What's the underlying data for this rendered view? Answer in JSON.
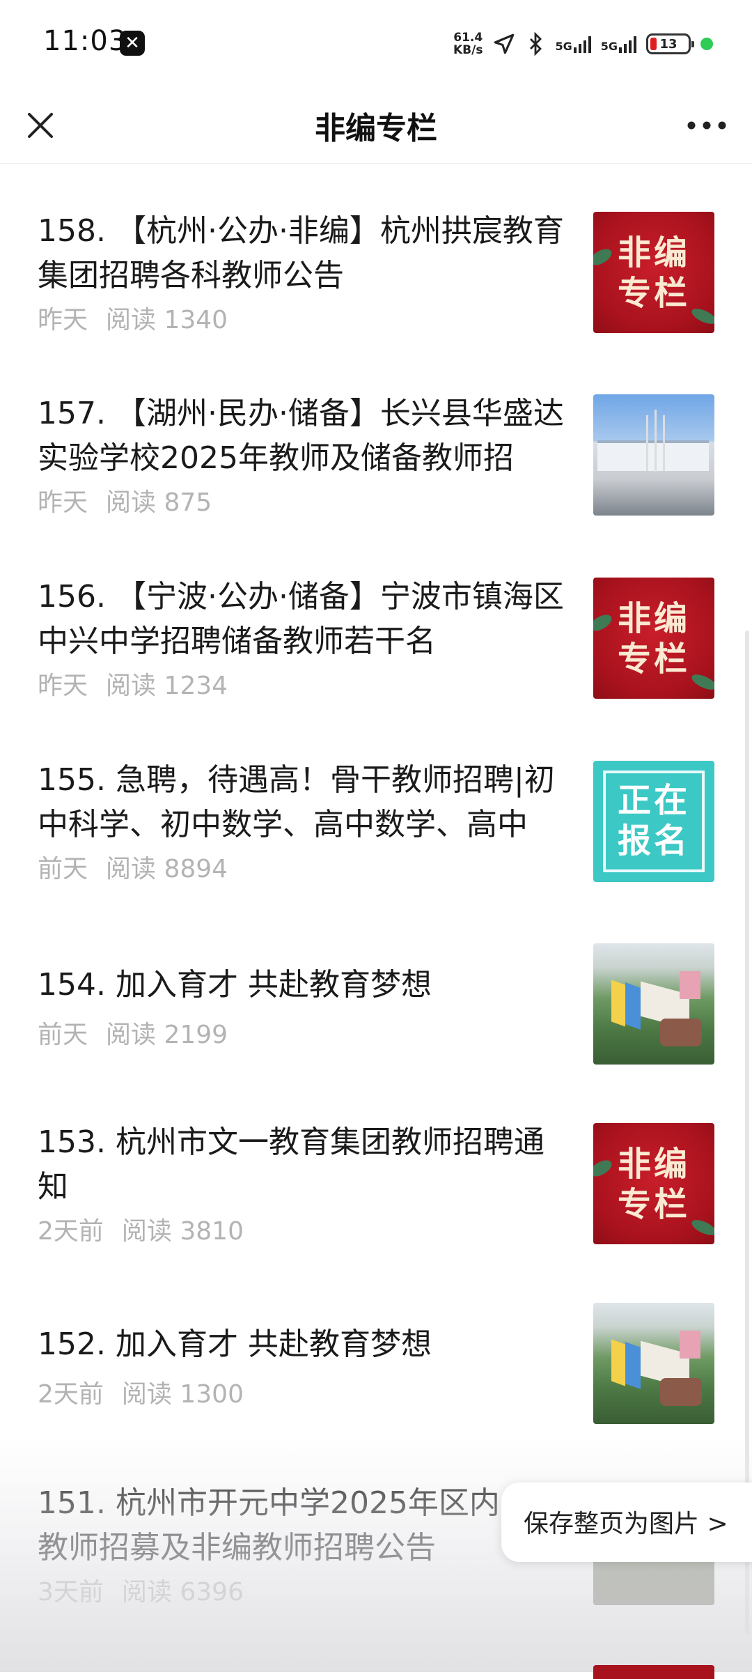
{
  "status_bar": {
    "time": "11:03",
    "net_speed_value": "61.4",
    "net_speed_unit": "KB/s",
    "signal1_label": "5G",
    "signal2_label": "5G",
    "battery_level": "13"
  },
  "nav": {
    "title": "非编专栏",
    "close_icon": "close-icon",
    "more_icon": "more-icon"
  },
  "articles": [
    {
      "title": "158. 【杭州·公办·非编】杭州拱宸教育集团招聘各科教师公告",
      "date": "昨天",
      "reads": "阅读 1340",
      "thumb_text1": "非编",
      "thumb_text2": "专栏",
      "thumb_type": "feiban"
    },
    {
      "title": "157. 【湖州·民办·储备】长兴县华盛达实验学校2025年教师及储备教师招",
      "date": "昨天",
      "reads": "阅读 875",
      "thumb_type": "school-photo"
    },
    {
      "title": "156. 【宁波·公办·储备】宁波市镇海区中兴中学招聘储备教师若干名",
      "date": "昨天",
      "reads": "阅读 1234",
      "thumb_text1": "非编",
      "thumb_text2": "专栏",
      "thumb_type": "feiban"
    },
    {
      "title": "155. 急聘，待遇高！骨干教师招聘|初中科学、初中数学、高中数学、高中",
      "date": "前天",
      "reads": "阅读 8894",
      "thumb_text1": "正在",
      "thumb_text2": "报名",
      "thumb_type": "signup"
    },
    {
      "title": "154. 加入育才 共赴教育梦想",
      "date": "前天",
      "reads": "阅读 2199",
      "thumb_type": "campus-photo"
    },
    {
      "title": "153. 杭州市文一教育集团教师招聘通知",
      "date": "2天前",
      "reads": "阅读 3810",
      "thumb_text1": "非编",
      "thumb_text2": "专栏",
      "thumb_type": "feiban"
    },
    {
      "title": "152. 加入育才 共赴教育梦想",
      "date": "2天前",
      "reads": "阅读 1300",
      "thumb_type": "campus-photo"
    },
    {
      "title": "151. 杭州市开元中学2025年区内教师招募及非编教师招聘公告",
      "date": "3天前",
      "reads": "阅读 6396",
      "thumb_type": "rock-photo"
    }
  ],
  "save_button_label": "保存整页为图片 >",
  "partial_next_title": "…"
}
